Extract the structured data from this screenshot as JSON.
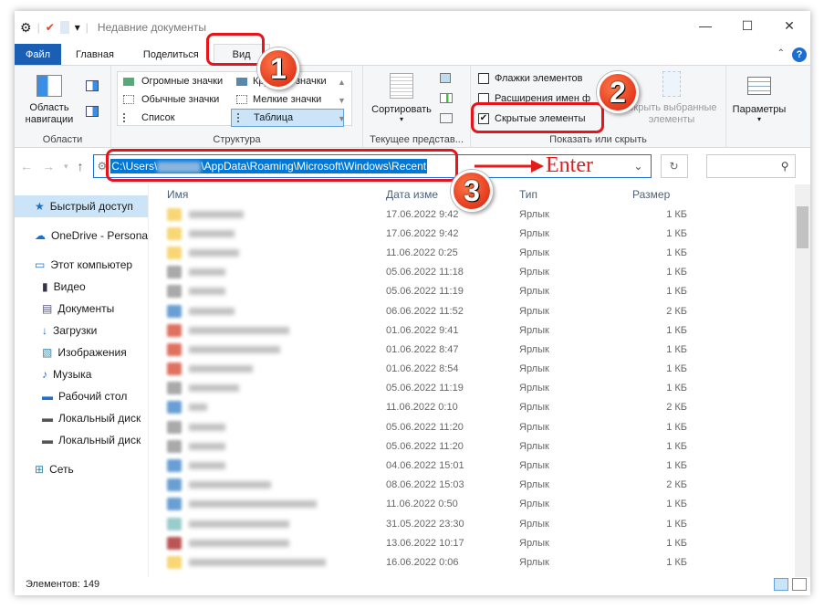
{
  "window": {
    "title": "Недавние документы"
  },
  "tabs": [
    "Файл",
    "Главная",
    "Поделиться",
    "Вид"
  ],
  "ribbon": {
    "areas": {
      "nav_pane": "Область навигации",
      "label": "Области"
    },
    "layout": {
      "items": [
        "Огромные значки",
        "Крупные значки",
        "Обычные значки",
        "Мелкие значки",
        "Список",
        "Таблица"
      ],
      "label": "Структура"
    },
    "current_view": {
      "sort": "Сортировать",
      "label": "Текущее представ..."
    },
    "show_hide": {
      "item_checkboxes": "Флажки элементов",
      "file_extensions": "Расширения имен ф",
      "hidden_items": "Скрытые элементы",
      "hide_selected": "Скрыть выбранные элементы",
      "label": "Показать или скрыть",
      "hidden_checked": true
    },
    "options": "Параметры"
  },
  "address": {
    "prefix": "C:\\Users\\",
    "suffix": "\\AppData\\Roaming\\Microsoft\\Windows\\Recent"
  },
  "annotation": {
    "enter": "Enter",
    "badges": [
      "1",
      "2",
      "3"
    ]
  },
  "sidebar": [
    "Быстрый доступ",
    "OneDrive - Persona",
    "Этот компьютер",
    "Видео",
    "Документы",
    "Загрузки",
    "Изображения",
    "Музыка",
    "Рабочий стол",
    "Локальный диск",
    "Локальный диск",
    "Сеть"
  ],
  "columns": [
    "Имя",
    "Дата изме",
    "Тип",
    "Размер"
  ],
  "rows": [
    [
      "17.06.2022 9:42",
      "Ярлык",
      "1 КБ"
    ],
    [
      "17.06.2022 9:42",
      "Ярлык",
      "1 КБ"
    ],
    [
      "11.06.2022 0:25",
      "Ярлык",
      "1 КБ"
    ],
    [
      "05.06.2022 11:18",
      "Ярлык",
      "1 КБ"
    ],
    [
      "05.06.2022 11:19",
      "Ярлык",
      "1 КБ"
    ],
    [
      "06.06.2022 11:52",
      "Ярлык",
      "2 КБ"
    ],
    [
      "01.06.2022 9:41",
      "Ярлык",
      "1 КБ"
    ],
    [
      "01.06.2022 8:47",
      "Ярлык",
      "1 КБ"
    ],
    [
      "01.06.2022 8:54",
      "Ярлык",
      "1 КБ"
    ],
    [
      "05.06.2022 11:19",
      "Ярлык",
      "1 КБ"
    ],
    [
      "11.06.2022 0:10",
      "Ярлык",
      "2 КБ"
    ],
    [
      "05.06.2022 11:20",
      "Ярлык",
      "1 КБ"
    ],
    [
      "05.06.2022 11:20",
      "Ярлык",
      "1 КБ"
    ],
    [
      "04.06.2022 15:01",
      "Ярлык",
      "1 КБ"
    ],
    [
      "08.06.2022 15:03",
      "Ярлык",
      "2 КБ"
    ],
    [
      "11.06.2022 0:50",
      "Ярлык",
      "1 КБ"
    ],
    [
      "31.05.2022 23:30",
      "Ярлык",
      "1 КБ"
    ],
    [
      "13.06.2022 10:17",
      "Ярлык",
      "1 КБ"
    ],
    [
      "16.06.2022 0:06",
      "Ярлык",
      "1 КБ"
    ]
  ],
  "status": "Элементов: 149"
}
